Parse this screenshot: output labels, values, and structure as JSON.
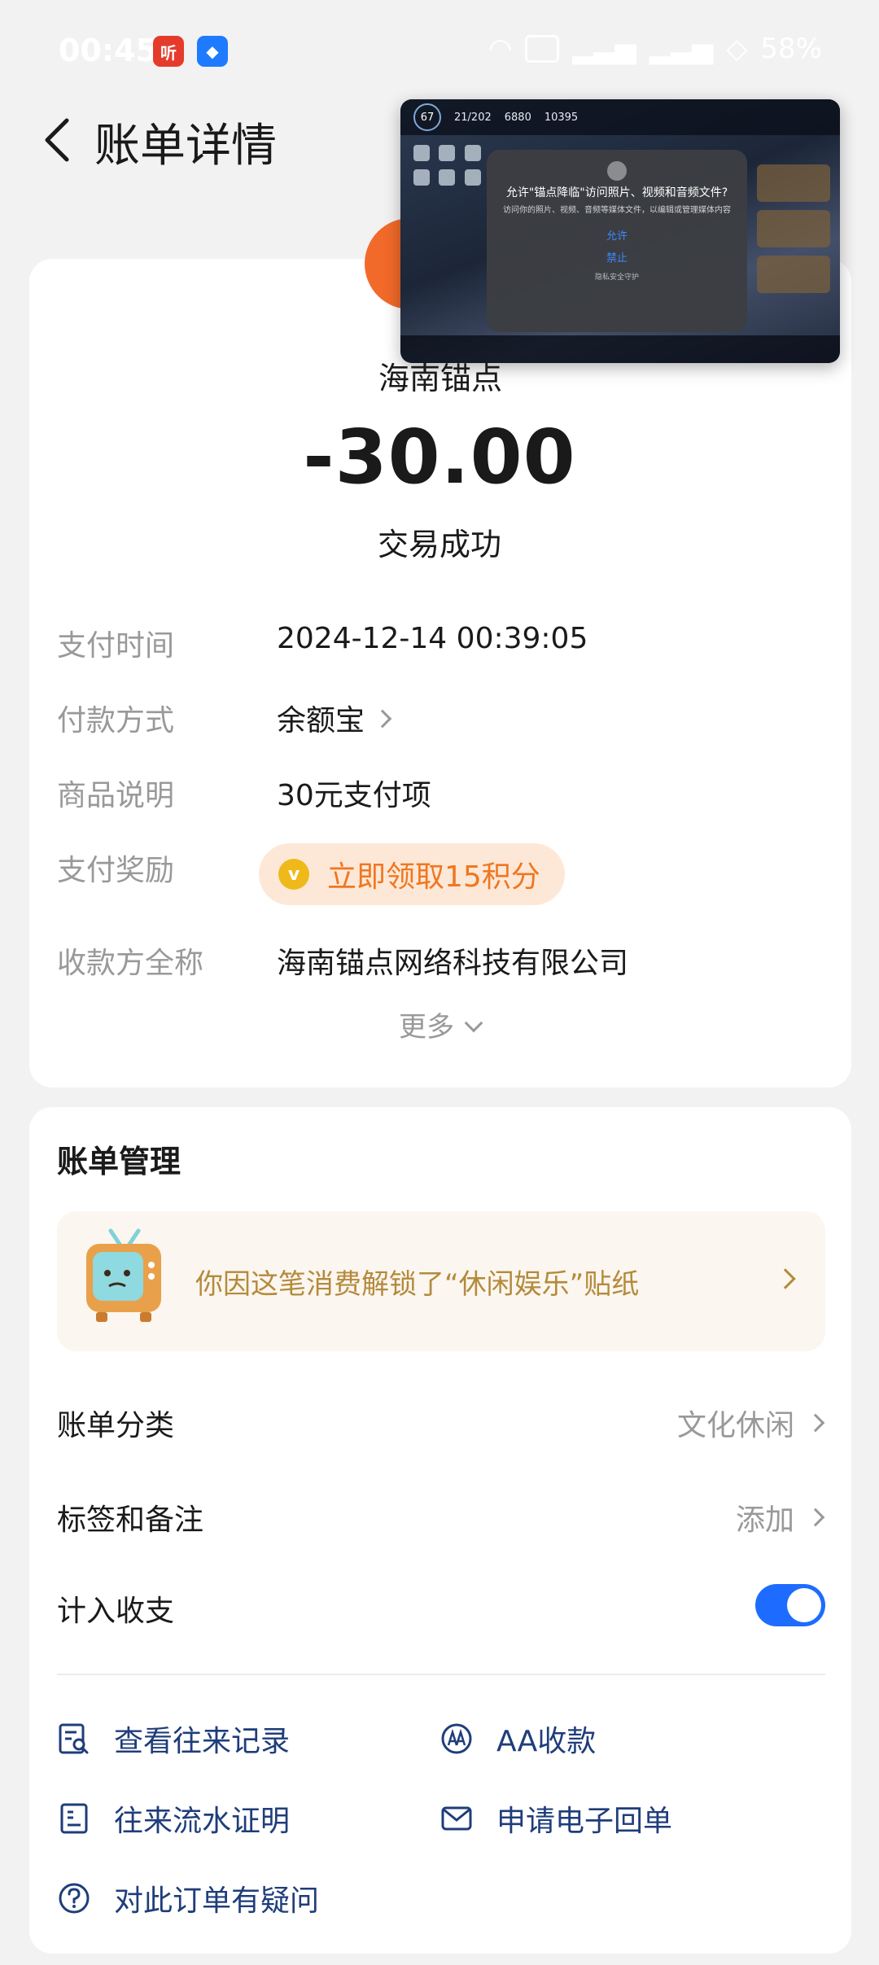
{
  "status_bar": {
    "time": "00:45",
    "app_icon_1": "听",
    "battery": "58%"
  },
  "header": {
    "title": "账单详情"
  },
  "floating_window": {
    "game_level": "67",
    "game_stat_1": "21/202",
    "game_stat_2": "6880",
    "game_stat_3": "10395",
    "dialog_title": "允许\"锚点降临\"访问照片、视频和音频文件?",
    "dialog_text": "访问你的照片、视频、音频等媒体文件，以编辑或管理媒体内容",
    "allow_label": "允许",
    "deny_label": "禁止",
    "note": "隐私安全守护"
  },
  "bill": {
    "merchant_name": "海南锚点",
    "amount": "-30.00",
    "status": "交易成功",
    "rows": {
      "pay_time_label": "支付时间",
      "pay_time_value": "2024-12-14 00:39:05",
      "pay_method_label": "付款方式",
      "pay_method_value": "余额宝",
      "product_label": "商品说明",
      "product_value": "30元支付项",
      "reward_label": "支付奖励",
      "reward_value": "立即领取15积分",
      "payee_label": "收款方全称",
      "payee_value": "海南锚点网络科技有限公司"
    },
    "more_label": "更多"
  },
  "management": {
    "title": "账单管理",
    "sticker_text": "你因这笔消费解锁了“休闲娱乐”贴纸",
    "category_label": "账单分类",
    "category_value": "文化休闲",
    "tags_label": "标签和备注",
    "tags_value": "添加",
    "include_label": "计入收支",
    "include_enabled": true
  },
  "actions": {
    "history": "查看往来记录",
    "aa": "AA收款",
    "statement": "往来流水证明",
    "receipt": "申请电子回单",
    "question": "对此订单有疑问"
  },
  "colors": {
    "accent_blue": "#1e6cff",
    "reward_orange": "#f0771e",
    "sticker_gold": "#b48a3c",
    "action_navy": "#1f3d7a"
  },
  "icons": {
    "back": "back-arrow-icon",
    "coin": "coin-icon",
    "tv": "tv-sticker-icon",
    "history": "record-search-icon",
    "aa": "aa-icon",
    "statement": "document-icon",
    "receipt": "envelope-icon",
    "question": "question-circle-icon"
  }
}
